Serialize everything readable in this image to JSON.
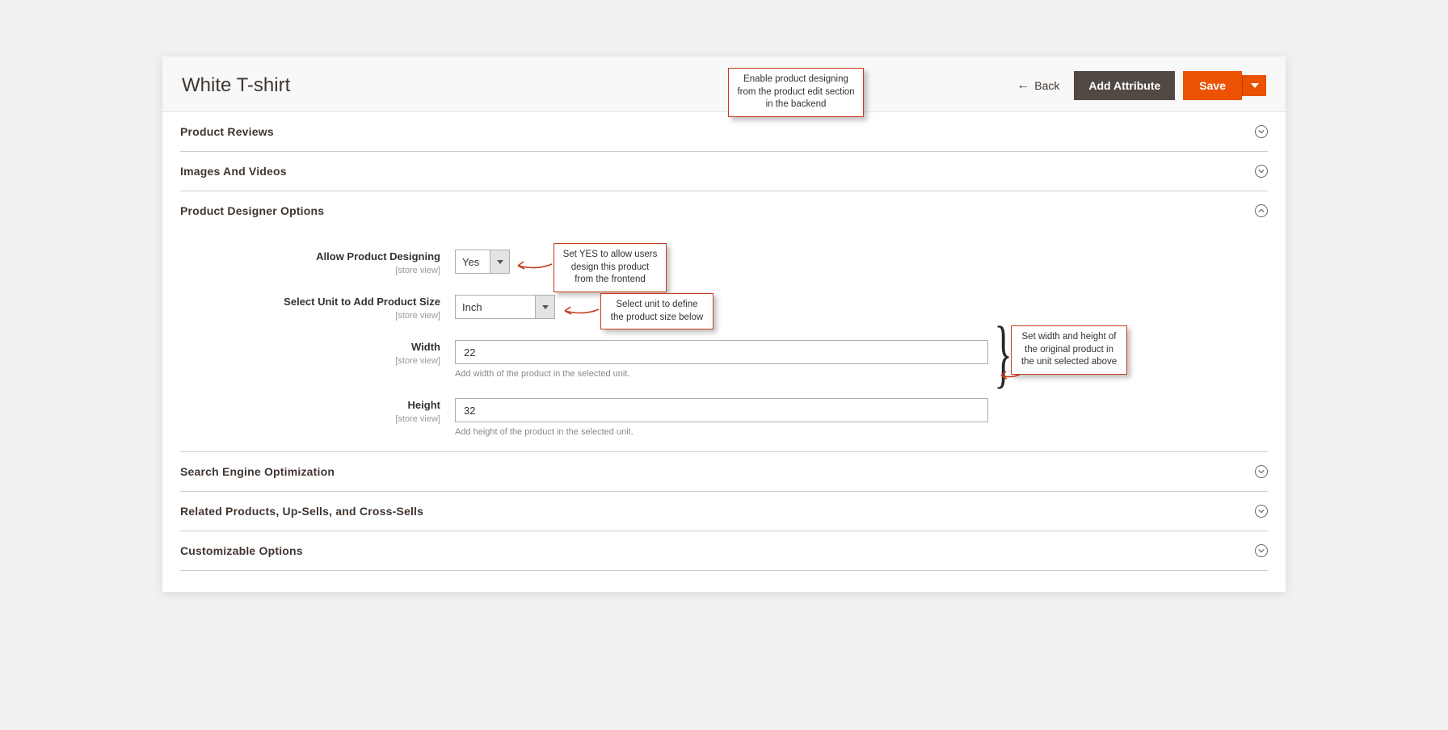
{
  "header": {
    "title": "White T-shirt",
    "back": "Back",
    "add_attribute": "Add Attribute",
    "save": "Save"
  },
  "callouts": {
    "top": "Enable product designing from the product edit section in the backend",
    "allow": "Set YES to allow users design this product from the frontend",
    "unit": "Select unit to define the product size below",
    "dims": "Set width and height of the original product in the unit selected above"
  },
  "sections": {
    "reviews": "Product Reviews",
    "images": "Images And Videos",
    "designer": "Product Designer Options",
    "seo": "Search Engine Optimization",
    "related": "Related Products, Up-Sells, and Cross-Sells",
    "customizable": "Customizable Options"
  },
  "form": {
    "allow": {
      "label": "Allow Product Designing",
      "scope": "[store view]",
      "value": "Yes"
    },
    "unit": {
      "label": "Select Unit to Add Product Size",
      "scope": "[store view]",
      "value": "Inch"
    },
    "width": {
      "label": "Width",
      "scope": "[store view]",
      "value": "22",
      "help": "Add width of the product in the selected unit."
    },
    "height": {
      "label": "Height",
      "scope": "[store view]",
      "value": "32",
      "help": "Add height of the product in the selected unit."
    }
  }
}
